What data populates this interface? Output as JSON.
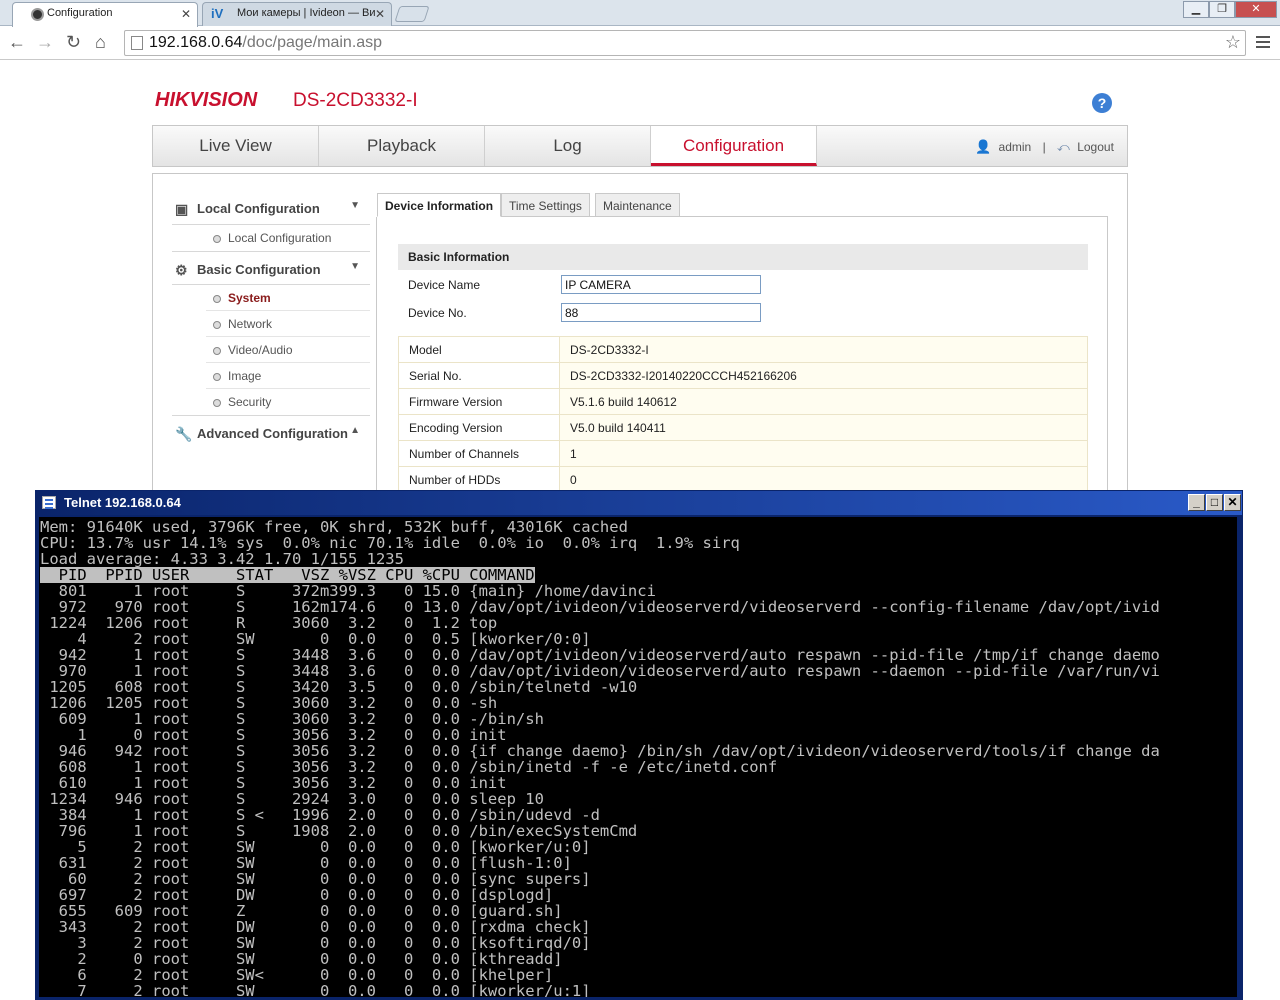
{
  "browser": {
    "tabs": [
      {
        "title": "Configuration",
        "active": true
      },
      {
        "title": "Мои камеры | Ivideon — Ви",
        "active": false
      }
    ],
    "url_host": "192.168.0.64",
    "url_path": "/doc/page/main.asp"
  },
  "app": {
    "brand": "HIKVISION",
    "model": "DS-2CD3332-I",
    "help": "?",
    "nav": [
      "Live View",
      "Playback",
      "Log",
      "Configuration"
    ],
    "user": "admin",
    "separator": "|",
    "logout": "Logout"
  },
  "sidebar": {
    "local_title": "Local Configuration",
    "local_items": [
      "Local Configuration"
    ],
    "basic_title": "Basic Configuration",
    "basic_items": [
      "System",
      "Network",
      "Video/Audio",
      "Image",
      "Security"
    ],
    "advanced_title": "Advanced Configuration"
  },
  "subtabs": [
    "Device Information",
    "Time Settings",
    "Maintenance"
  ],
  "basic_info": {
    "heading": "Basic Information",
    "device_name_label": "Device Name",
    "device_name_value": "IP CAMERA",
    "device_no_label": "Device No.",
    "device_no_value": "88",
    "rows": [
      {
        "label": "Model",
        "value": "DS-2CD3332-I"
      },
      {
        "label": "Serial No.",
        "value": "DS-2CD3332-I20140220CCCH452166206"
      },
      {
        "label": "Firmware Version",
        "value": "V5.1.6 build 140612"
      },
      {
        "label": "Encoding Version",
        "value": "V5.0 build 140411"
      },
      {
        "label": "Number of Channels",
        "value": "1"
      },
      {
        "label": "Number of HDDs",
        "value": "0"
      }
    ]
  },
  "telnet": {
    "title": "Telnet 192.168.0.64",
    "summary": [
      "Mem: 91640K used, 3796K free, 0K shrd, 532K buff, 43016K cached",
      "CPU: 13.7% usr 14.1% sys  0.0% nic 70.1% idle  0.0% io  0.0% irq  1.9% sirq",
      "Load average: 4.33 3.42 1.70 1/155 1235"
    ],
    "header": "  PID  PPID USER     STAT   VSZ %VSZ CPU %CPU COMMAND",
    "processes": [
      "  801     1 root     S     372m399.3   0 15.0 {main} /home/davinci",
      "  972   970 root     S     162m174.6   0 13.0 /dav/opt/ivideon/videoserverd/videoserverd --config-filename /dav/opt/ivid",
      " 1224  1206 root     R     3060  3.2   0  1.2 top",
      "    4     2 root     SW       0  0.0   0  0.5 [kworker/0:0]",
      "  942     1 root     S     3448  3.6   0  0.0 /dav/opt/ivideon/videoserverd/auto_respawn --pid-file /tmp/if_change_daemo",
      "  970     1 root     S     3448  3.6   0  0.0 /dav/opt/ivideon/videoserverd/auto_respawn --daemon --pid-file /var/run/vi",
      " 1205   608 root     S     3420  3.5   0  0.0 /sbin/telnetd -w10",
      " 1206  1205 root     S     3060  3.2   0  0.0 -sh",
      "  609     1 root     S     3060  3.2   0  0.0 -/bin/sh",
      "    1     0 root     S     3056  3.2   0  0.0 init",
      "  946   942 root     S     3056  3.2   0  0.0 {if_change_daemo} /bin/sh /dav/opt/ivideon/videoserverd/tools/if_change_da",
      "  608     1 root     S     3056  3.2   0  0.0 /sbin/inetd -f -e /etc/inetd.conf",
      "  610     1 root     S     3056  3.2   0  0.0 init",
      " 1234   946 root     S     2924  3.0   0  0.0 sleep 10",
      "  384     1 root     S <   1996  2.0   0  0.0 /sbin/udevd -d",
      "  796     1 root     S     1908  2.0   0  0.0 /bin/execSystemCmd",
      "    5     2 root     SW       0  0.0   0  0.0 [kworker/u:0]",
      "  631     2 root     SW       0  0.0   0  0.0 [flush-1:0]",
      "   60     2 root     SW       0  0.0   0  0.0 [sync_supers]",
      "  697     2 root     DW       0  0.0   0  0.0 [dsplogd]",
      "  655   609 root     Z        0  0.0   0  0.0 [guard.sh]",
      "  343     2 root     DW       0  0.0   0  0.0 [rxdma_check]",
      "    3     2 root     SW       0  0.0   0  0.0 [ksoftirqd/0]",
      "    2     0 root     SW       0  0.0   0  0.0 [kthreadd]",
      "    6     2 root     SW<      0  0.0   0  0.0 [khelper]",
      "    7     2 root     SW       0  0.0   0  0.0 [kworker/u:1]"
    ]
  }
}
